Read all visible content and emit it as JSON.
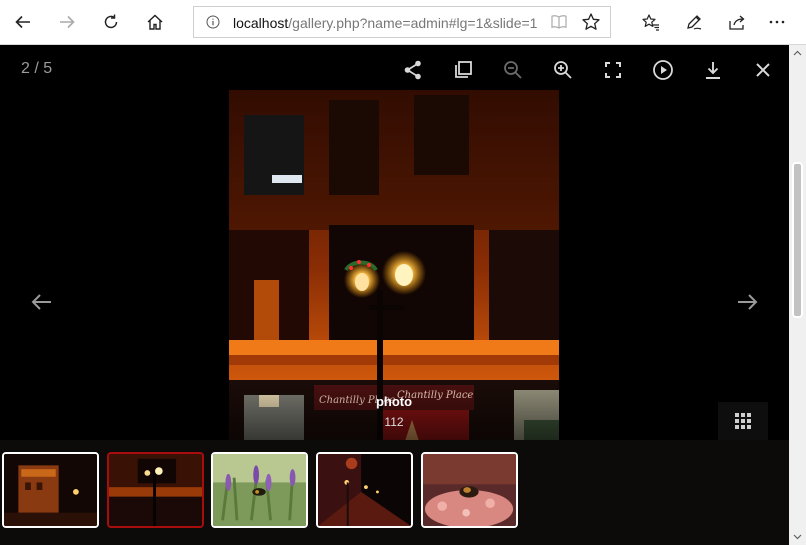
{
  "browser": {
    "url_host": "localhost",
    "url_path": "/gallery.php?name=admin#lg=1&slide=1",
    "icons": [
      "back-icon",
      "forward-icon",
      "refresh-icon",
      "home-icon",
      "info-icon",
      "reading-view-icon",
      "favorite-star-icon",
      "favorites-hub-icon",
      "pen-icon",
      "share-icon",
      "more-icon"
    ]
  },
  "lightbox": {
    "counter": "2 / 5",
    "caption_title": "photo",
    "caption_subtitle": "112",
    "tools": [
      "share-icon",
      "copy-icon",
      "zoom-out-icon",
      "zoom-in-icon",
      "fullscreen-icon",
      "play-icon",
      "download-icon",
      "close-icon"
    ],
    "thumbnails": [
      {
        "subject": "brick building at night"
      },
      {
        "subject": "street lamp and storefront",
        "active": true
      },
      {
        "subject": "bee on lavender"
      },
      {
        "subject": "street lights at night"
      },
      {
        "subject": "bee on flower"
      }
    ],
    "colors": {
      "active_thumb_border": "#a80c0c",
      "background": "#000000"
    }
  }
}
